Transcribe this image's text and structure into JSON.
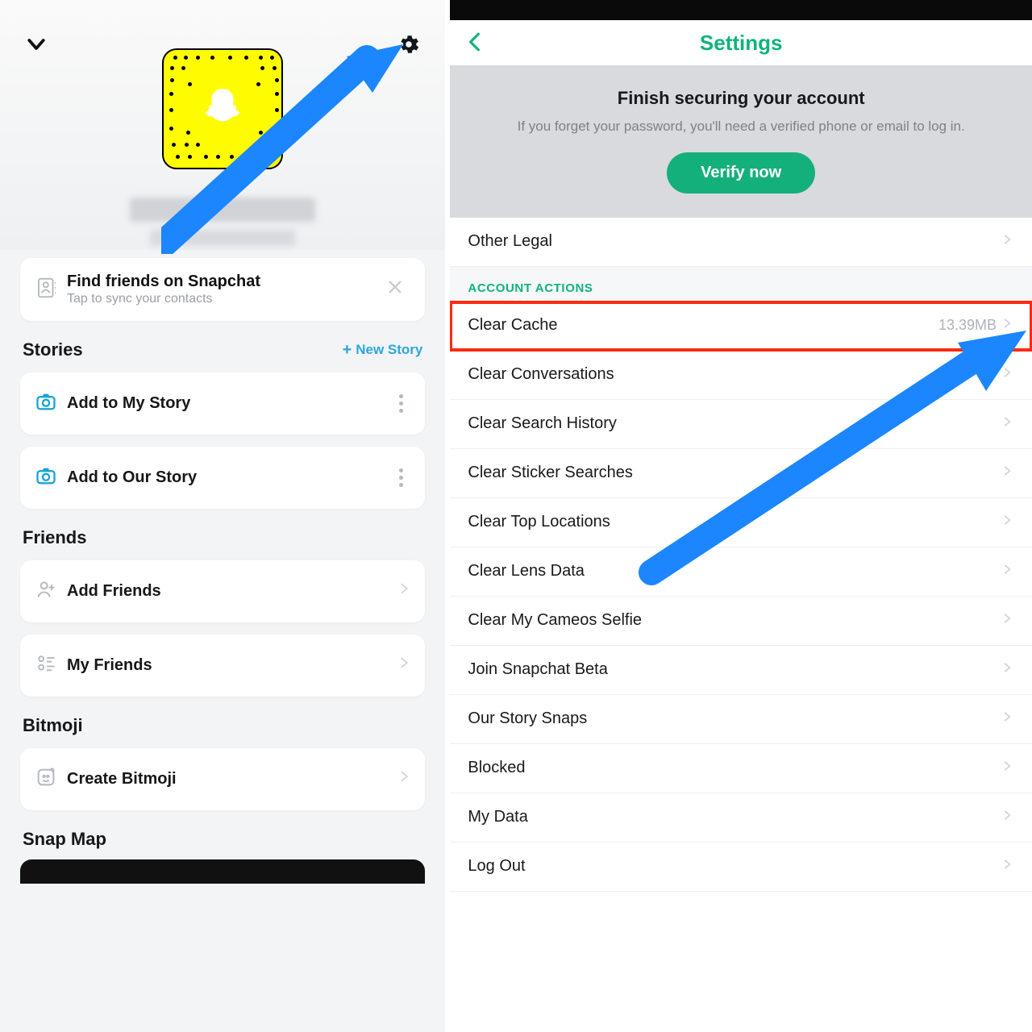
{
  "left": {
    "profile": {
      "find_friends_title": "Find friends on Snapchat",
      "find_friends_sub": "Tap to sync your contacts"
    },
    "stories": {
      "heading": "Stories",
      "new_story": "New Story",
      "items": [
        {
          "label": "Add to My Story"
        },
        {
          "label": "Add to Our Story"
        }
      ]
    },
    "friends": {
      "heading": "Friends",
      "items": [
        {
          "label": "Add Friends"
        },
        {
          "label": "My Friends"
        }
      ]
    },
    "bitmoji": {
      "heading": "Bitmoji",
      "items": [
        {
          "label": "Create Bitmoji"
        }
      ]
    },
    "snapmap_heading": "Snap Map"
  },
  "right": {
    "title": "Settings",
    "secure": {
      "heading": "Finish securing your account",
      "body": "If you forget your password, you'll need a verified phone or email to log in.",
      "button": "Verify now"
    },
    "other_legal": "Other Legal",
    "section_header": "ACCOUNT ACTIONS",
    "rows": [
      {
        "label": "Clear Cache",
        "value": "13.39MB",
        "highlight": true
      },
      {
        "label": "Clear Conversations"
      },
      {
        "label": "Clear Search History"
      },
      {
        "label": "Clear Sticker Searches"
      },
      {
        "label": "Clear Top Locations"
      },
      {
        "label": "Clear Lens Data"
      },
      {
        "label": "Clear My Cameos Selfie"
      },
      {
        "label": "Join Snapchat Beta"
      },
      {
        "label": "Our Story Snaps"
      },
      {
        "label": "Blocked"
      },
      {
        "label": "My Data"
      },
      {
        "label": "Log Out"
      }
    ]
  }
}
